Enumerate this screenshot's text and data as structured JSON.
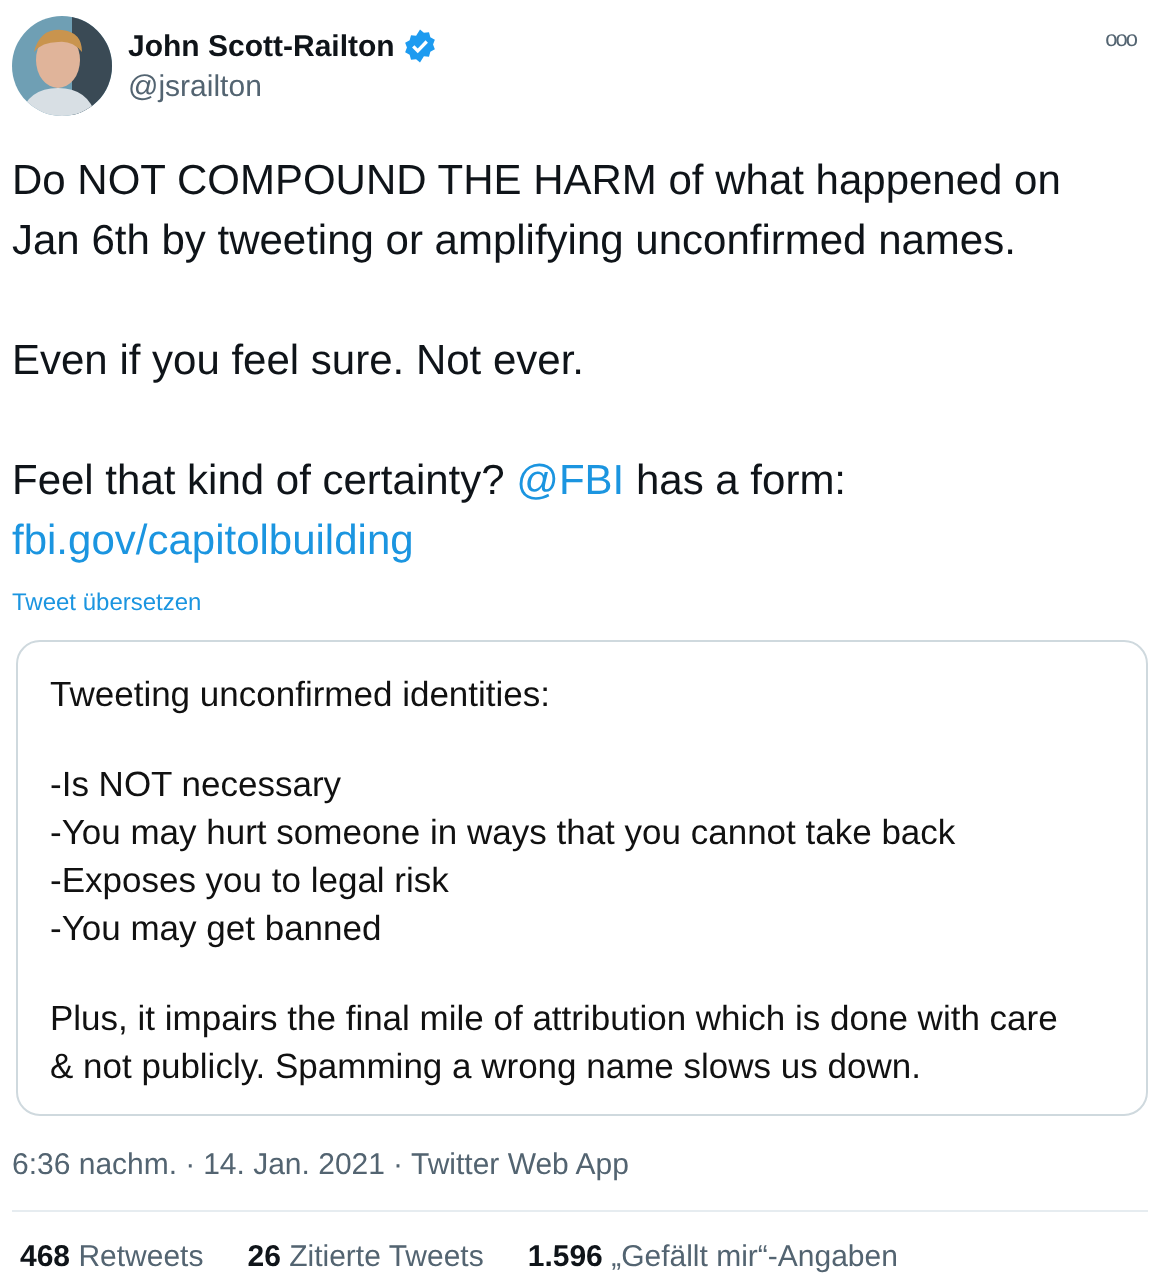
{
  "author": {
    "name": "John Scott-Railton",
    "verified": true,
    "handle": "@jsrailton"
  },
  "more_menu": "ooo",
  "body": [
    [
      {
        "kind": "text",
        "text": "Do NOT COMPOUND THE HARM of what happened on Jan 6th by tweeting or amplifying unconfirmed names."
      }
    ],
    [
      {
        "kind": "text",
        "text": "Even if you feel sure. Not ever."
      }
    ],
    [
      {
        "kind": "text",
        "text": "Feel that kind of certainty? "
      },
      {
        "kind": "mention",
        "text": "@FBI"
      },
      {
        "kind": "text",
        "text": " has a form: "
      },
      {
        "kind": "link",
        "text": "fbi.gov/capitolbuilding"
      }
    ]
  ],
  "translate_link": "Tweet übersetzen",
  "image_card": {
    "heading": "Tweeting unconfirmed identities:",
    "points": [
      "-Is NOT necessary",
      "-You may hurt someone in ways that you cannot take back",
      "-Exposes you to legal risk",
      "-You may get banned"
    ],
    "closing": "Plus, it impairs the final mile of attribution which is done with care & not publicly. Spamming a wrong name slows us down."
  },
  "meta": [
    "6:36 nachm.",
    "14. Jan. 2021",
    "Twitter Web App"
  ],
  "meta_separator": "·",
  "stats": [
    {
      "count": "468",
      "label": "Retweets"
    },
    {
      "count": "26",
      "label": "Zitierte Tweets"
    },
    {
      "count": "1.596",
      "label": "„Gefällt mir“-Angaben"
    }
  ]
}
